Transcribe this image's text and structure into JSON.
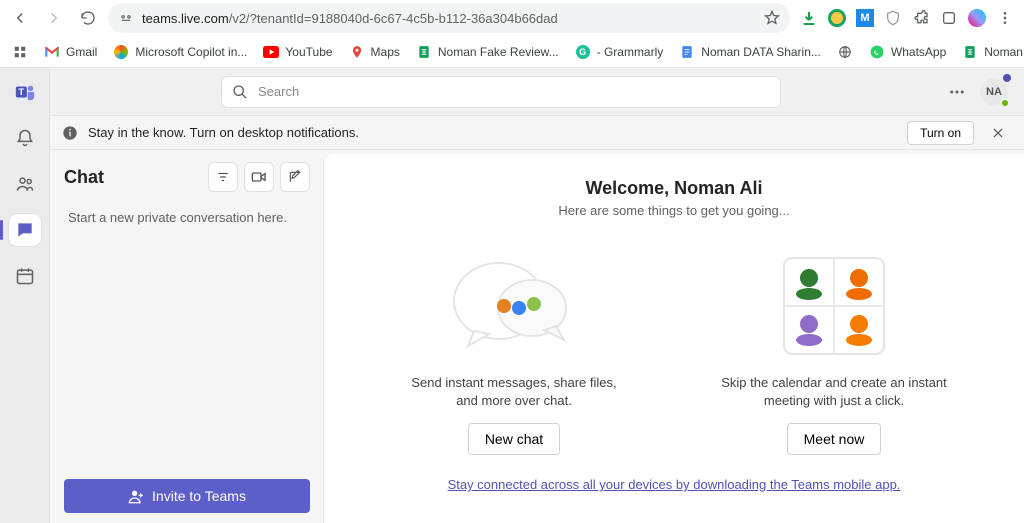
{
  "browser": {
    "url_host": "teams.live.com",
    "url_rest": "/v2/?tenantId=9188040d-6c67-4c5b-b112-36a304b66dad"
  },
  "bookmarks": {
    "gmail": "Gmail",
    "copilot": "Microsoft Copilot in...",
    "youtube": "YouTube",
    "maps": "Maps",
    "fakerev": "Noman Fake Review...",
    "grammarly": "- Grammarly",
    "datasharing": "Noman DATA Sharin...",
    "whatsapp": "WhatsApp",
    "articles": "Noman Artilces - G..."
  },
  "header": {
    "search_placeholder": "Search",
    "avatar_initials": "NA"
  },
  "notification": {
    "text": "Stay in the know. Turn on desktop notifications.",
    "turn_on": "Turn on"
  },
  "chat": {
    "title": "Chat",
    "empty_text": "Start a new private conversation here.",
    "invite_label": "Invite to Teams"
  },
  "welcome": {
    "title": "Welcome, Noman Ali",
    "subtitle": "Here are some things to get you going...",
    "card1_text": "Send instant messages, share files, and more over chat.",
    "card1_btn": "New chat",
    "card2_text": "Skip the calendar and create an instant meeting with just a click.",
    "card2_btn": "Meet now",
    "download_link": "Stay connected across all your devices by downloading the Teams mobile app."
  }
}
